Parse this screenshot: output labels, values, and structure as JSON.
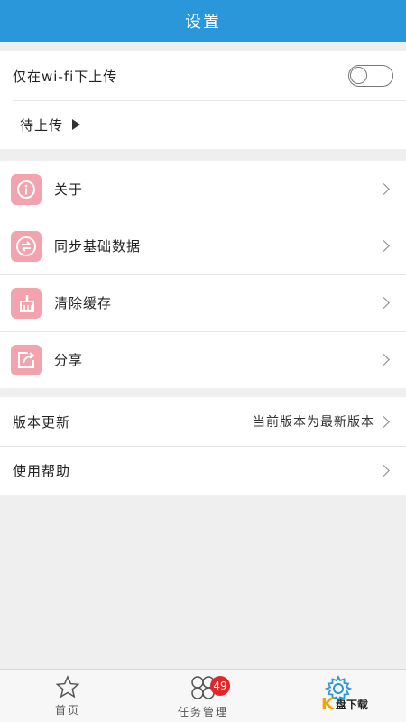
{
  "header": {
    "title": "设置"
  },
  "upload": {
    "wifi_only_label": "仅在wi-fi下上传",
    "wifi_only_enabled": false,
    "pending_label": "待上传"
  },
  "menu": {
    "items": [
      {
        "label": "关于",
        "icon": "info-icon"
      },
      {
        "label": "同步基础数据",
        "icon": "sync-icon"
      },
      {
        "label": "清除缓存",
        "icon": "broom-icon"
      },
      {
        "label": "分享",
        "icon": "share-icon"
      }
    ]
  },
  "more": {
    "version_label": "版本更新",
    "version_status": "当前版本为最新版本",
    "help_label": "使用帮助"
  },
  "tabbar": {
    "tabs": [
      {
        "label": "首页",
        "icon": "star-icon"
      },
      {
        "label": "任务管理",
        "icon": "tasks-icon",
        "badge": "49"
      },
      {
        "label": "",
        "icon": "gear-icon"
      }
    ]
  },
  "watermark": {
    "text": "盘下载"
  },
  "colors": {
    "header": "#2b97db",
    "icon_bg": "#f2a3ad",
    "badge": "#e0262b"
  }
}
